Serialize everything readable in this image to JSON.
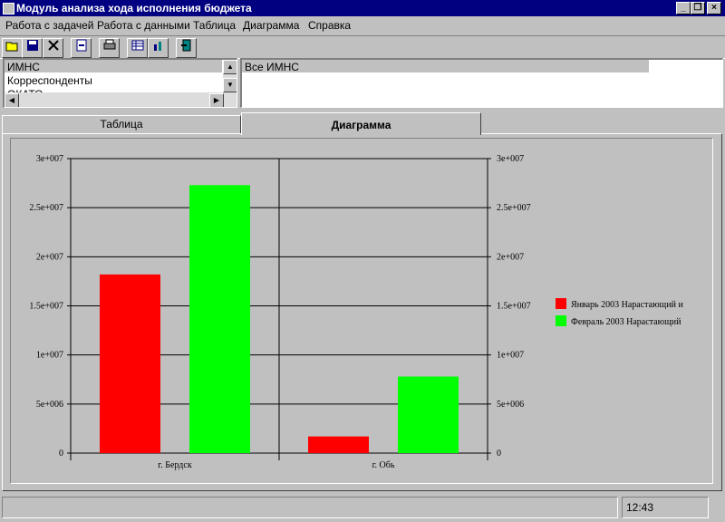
{
  "window": {
    "title": "Модуль анализа хода исполнения бюджета"
  },
  "menu": [
    "Работа с задачей",
    "Работа с данными",
    "Таблица",
    "Диаграмма",
    "Справка"
  ],
  "toolbar": {
    "icons": [
      "open-folder-icon",
      "save-disk-icon",
      "delete-cross-icon",
      "import-icon",
      "print-icon",
      "table-grid-icon",
      "chart-icon",
      "exit-door-icon"
    ]
  },
  "left_list": {
    "items": [
      "ИМНС",
      "Корреспонденты",
      "ОКАТО"
    ]
  },
  "right_list": {
    "items": [
      "Все ИМНС"
    ]
  },
  "tabs": [
    "Таблица",
    "Диаграмма"
  ],
  "active_tab": "Диаграмма",
  "colors": {
    "series1": "#ff0000",
    "series2": "#00ff00"
  },
  "chart_data": {
    "type": "bar",
    "categories": [
      "г. Бердск",
      "г. Обь"
    ],
    "series": [
      {
        "name": "Январь 2003 Нарастающий и",
        "values": [
          18200000,
          1700000
        ]
      },
      {
        "name": "Февраль 2003 Нарастающий",
        "values": [
          27300000,
          7800000
        ]
      }
    ],
    "yticks": [
      "0",
      "5e+006",
      "1e+007",
      "1.5e+007",
      "2e+007",
      "2.5e+007",
      "3e+007"
    ],
    "ylim": [
      0,
      30000000
    ],
    "grid": true,
    "legend": "right"
  },
  "statusbar": {
    "left": "",
    "right": "12:43"
  }
}
